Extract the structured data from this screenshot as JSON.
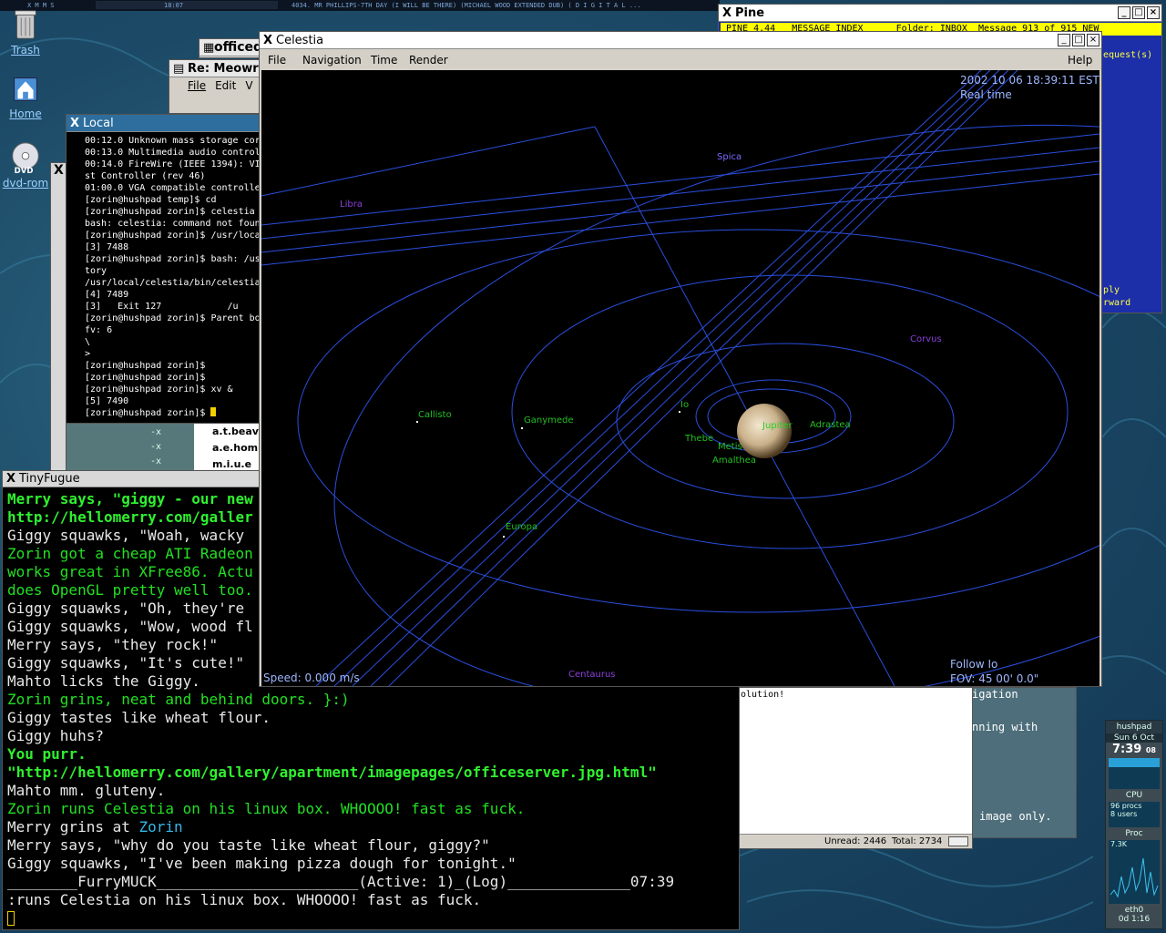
{
  "xmms": {
    "left_text": "X M M S",
    "time": "18:07",
    "track": "4034. MR PHILLIPS-7TH DAY (I WILL BE THERE) (MICHAEL WOOD EXTENDED DUB) ( D I G I T A L ..."
  },
  "desktop_icons": [
    {
      "label": "Trash",
      "icon": "trash-icon"
    },
    {
      "label": "Home",
      "icon": "home-icon"
    },
    {
      "label": "dvd-rom",
      "icon": "dvd-icon"
    }
  ],
  "background_windows": {
    "officed_title": "officed",
    "meow_title": "Re: Meowrr",
    "meow_menu": [
      "File",
      "Edit",
      "V"
    ],
    "x_char": "X",
    "file_list": [
      "a.t.beav",
      "a.e.hom",
      "m.i.u.e"
    ],
    "perms": [
      "-x",
      "-x",
      "-x"
    ]
  },
  "local_terminal": {
    "title": "Local",
    "lines": [
      "00:12.0 Unknown mass storage cor",
      "00:13.0 Multimedia audio control",
      "00:14.0 FireWire (IEEE 1394): VI",
      "st Controller (rev 46)",
      "01:00.0 VGA compatible controlle",
      "[zorin@hushpad temp]$ cd",
      "[zorin@hushpad zorin]$ celestia",
      "bash: celestia: command not foun",
      "[zorin@hushpad zorin]$ /usr/loca",
      "[3] 7488",
      "[zorin@hushpad zorin]$ bash: /us",
      "tory",
      "/usr/local/celestia/bin/celestia",
      "[4] 7489",
      "[3]   Exit 127            /u",
      "[zorin@hushpad zorin]$ Parent bo",
      "fv: 6",
      "\\",
      ">",
      "[zorin@hushpad zorin]$",
      "[zorin@hushpad zorin]$",
      "[zorin@hushpad zorin]$ xv &",
      "[5] 7490",
      "[zorin@hushpad zorin]$ "
    ]
  },
  "tinyfugue": {
    "title": "TinyFugue",
    "lines": [
      {
        "text": "Merry says, \"giggy - our new",
        "color": "bg"
      },
      {
        "text": "http://hellomerry.com/galler",
        "color": "bg"
      },
      {
        "text": "Giggy squawks, \"Woah, wacky",
        "color": "w"
      },
      {
        "text": "Zorin got a cheap ATI Radeon",
        "color": "g"
      },
      {
        "text": "works great in XFree86. Actu",
        "color": "g"
      },
      {
        "text": "does OpenGL pretty well too.",
        "color": "g"
      },
      {
        "text": "Giggy squawks, \"Oh, they're",
        "color": "w"
      },
      {
        "text": "Giggy squawks, \"Wow, wood fl",
        "color": "w"
      },
      {
        "text": "Merry says, \"they rock!\"",
        "color": "w"
      },
      {
        "text": "Giggy squawks, \"It's cute!\"",
        "color": "w"
      },
      {
        "text": "Mahto licks the Giggy.",
        "color": "w"
      },
      {
        "text": "Zorin grins, neat and behind doors. }:)",
        "color": "g"
      },
      {
        "text": "Giggy tastes like wheat flour.",
        "color": "w"
      },
      {
        "text": "Giggy huhs?",
        "color": "w"
      },
      {
        "text": "You purr.",
        "color": "bg"
      },
      {
        "text": "\"http://hellomerry.com/gallery/apartment/imagepages/officeserver.jpg.html\"",
        "color": "bg"
      },
      {
        "text": "Mahto mm. gluteny.",
        "color": "w"
      },
      {
        "text": "Zorin runs Celestia on his linux box. WHOOOO! fast as fuck.",
        "color": "g"
      },
      {
        "text": "Merry grins at ",
        "color": "w",
        "suffix": "Zorin"
      },
      {
        "text": "Merry says, \"why do you taste like wheat flour, giggy?\"",
        "color": "w"
      },
      {
        "text": "Giggy squawks, \"I've been making pizza dough for tonight.\"",
        "color": "w"
      },
      {
        "text": "________FurryMUCK_______________________(Active: 1)_(Log)______________07:39",
        "color": "w"
      },
      {
        "text": ":runs Celestia on his linux box. WHOOOO! fast as fuck.",
        "color": "w"
      }
    ]
  },
  "celestia": {
    "title": "Celestia",
    "menu": [
      "File",
      "Navigation",
      "Time",
      "Render",
      "Help"
    ],
    "datetime": "2002 10 06 18:39:11 EST",
    "timemode": "Real time",
    "speed": "Speed: 0.000 m/s",
    "follow": "Follow Io",
    "fov": "FOV: 45 00' 0.0\"",
    "constellations": [
      "Spica",
      "Libra",
      "Corvus",
      "Centaurus"
    ],
    "planet": "Jupiter",
    "moons": [
      "Callisto",
      "Ganymede",
      "Io",
      "Europa",
      "Thebe",
      "Metis",
      "Amalthea",
      "Adrastea"
    ],
    "colors": {
      "orbit": "#2a4fe0",
      "constellation": "#8a3fd8",
      "moon_label": "#22d022",
      "hud": "#9fb7ff"
    }
  },
  "pine": {
    "title": "Pine",
    "header": " PINE 4.44   MESSAGE INDEX      Folder: INBOX  Message 913 of 915 NEW",
    "side_lines": [
      "equest(s)",
      "ply",
      "rward"
    ]
  },
  "mail_preview": {
    "text": "olution!",
    "unread": "Unread: 2446",
    "total": "Total: 2734"
  },
  "grey_box": {
    "lines": [
      "igation",
      "nning with",
      "image only."
    ]
  },
  "gkrellm": {
    "host": "hushpad",
    "date": "Sun 6 Oct",
    "time": "7:39",
    "secs": "08",
    "cpu_label": "CPU",
    "procs": "96 procs",
    "users": "8 users",
    "proc_label": "Proc",
    "net_value": "7.3K",
    "net_label": "eth0",
    "uptime": "0d 1:16"
  }
}
